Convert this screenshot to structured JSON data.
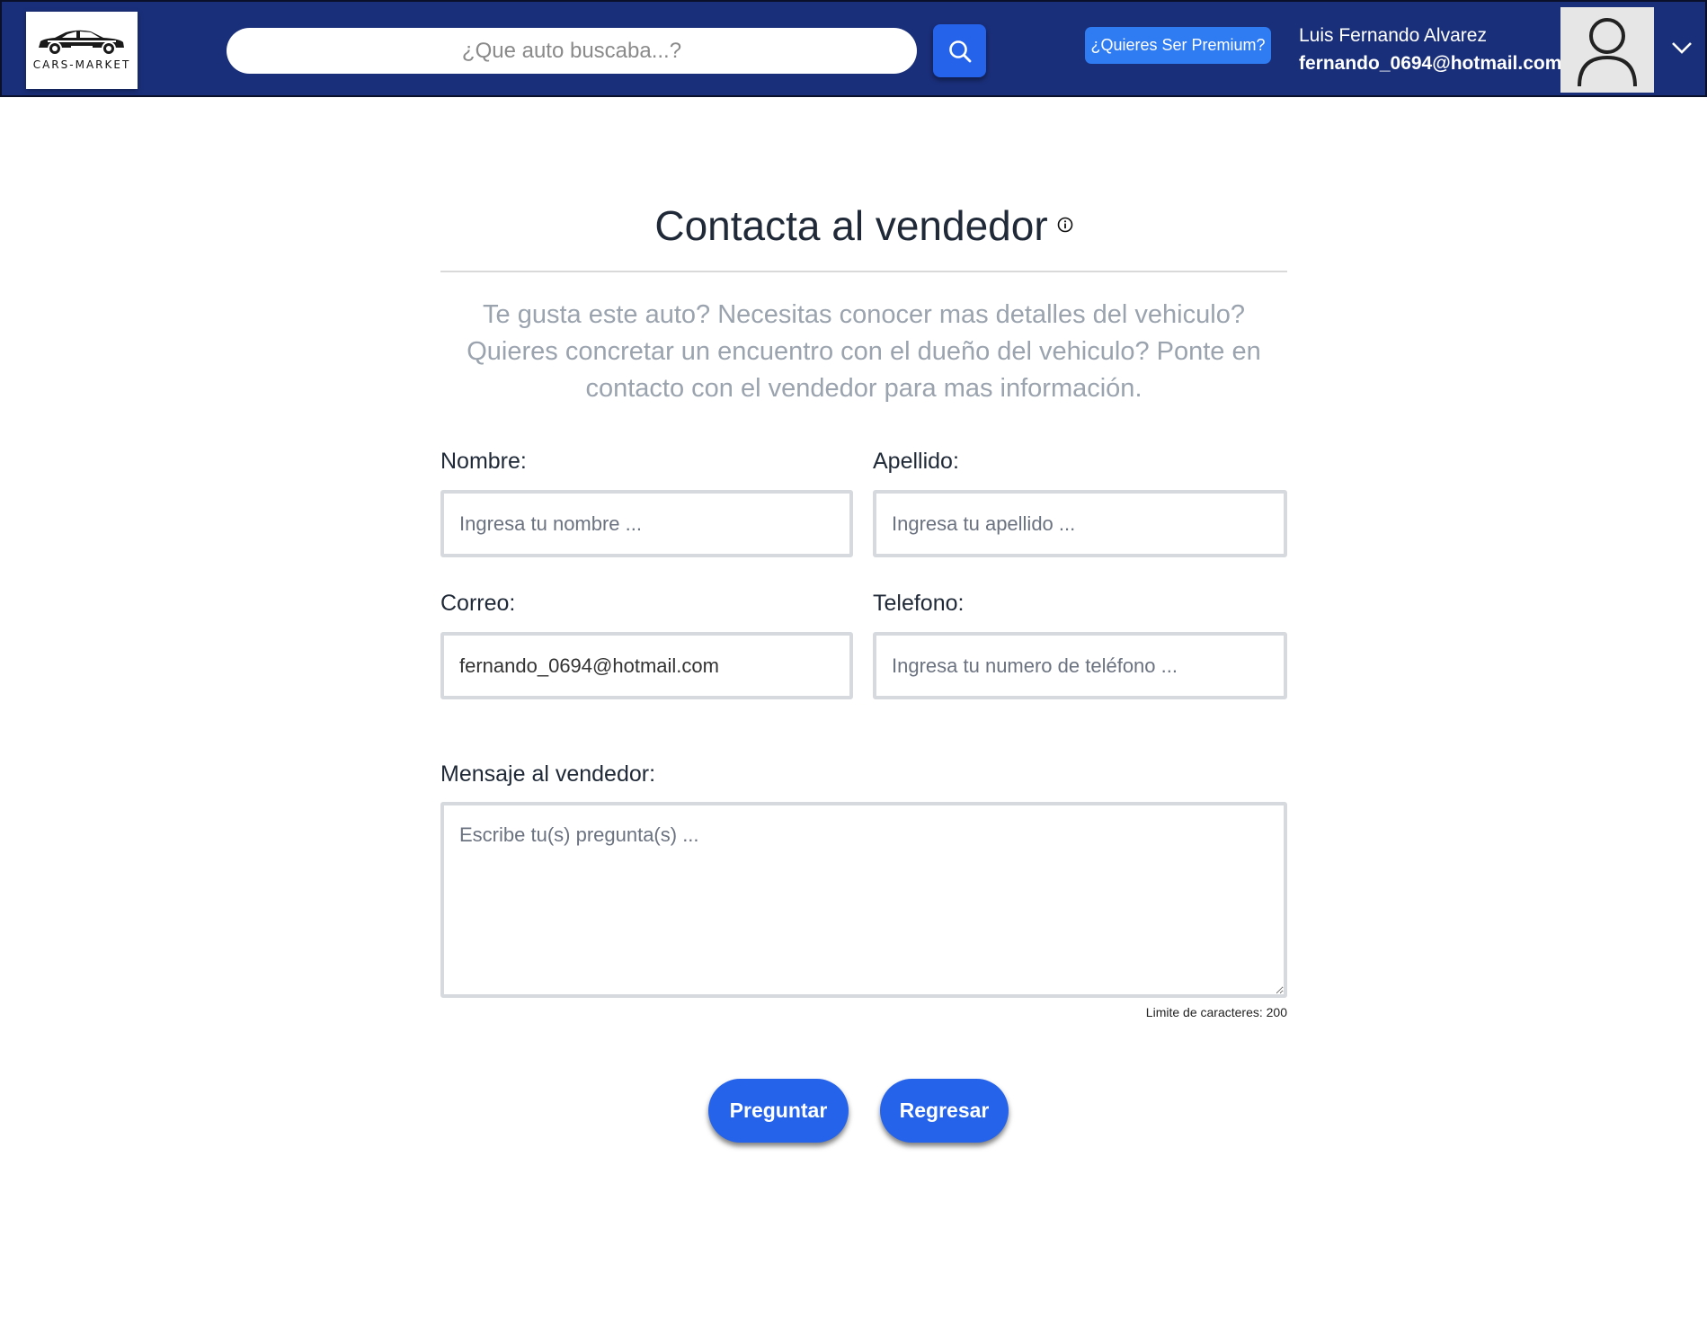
{
  "header": {
    "logo_text": "CARS-MARKET",
    "search_placeholder": "¿Que auto buscaba...?",
    "premium_label": "¿Quieres Ser Premium?",
    "user_name": "Luis Fernando Alvarez",
    "user_email": "fernando_0694@hotmail.com"
  },
  "main": {
    "title": "Contacta al vendedor",
    "description": "Te gusta este auto? Necesitas conocer mas detalles del vehiculo? Quieres concretar un encuentro con el dueño del vehiculo? Ponte en contacto con el vendedor para mas información.",
    "form": {
      "nombre_label": "Nombre:",
      "nombre_placeholder": "Ingresa tu nombre ...",
      "apellido_label": "Apellido:",
      "apellido_placeholder": "Ingresa tu apellido ...",
      "correo_label": "Correo:",
      "correo_value": "fernando_0694@hotmail.com",
      "telefono_label": "Telefono:",
      "telefono_placeholder": "Ingresa tu numero de teléfono ...",
      "mensaje_label": "Mensaje al vendedor:",
      "mensaje_placeholder": "Escribe tu(s) pregunta(s) ...",
      "char_limit": "Limite de caracteres: 200"
    },
    "buttons": {
      "preguntar": "Preguntar",
      "regresar": "Regresar"
    }
  },
  "colors": {
    "navbar": "#1a2f7a",
    "primary_button": "#2563eb",
    "premium_button": "#2f7bf2"
  }
}
